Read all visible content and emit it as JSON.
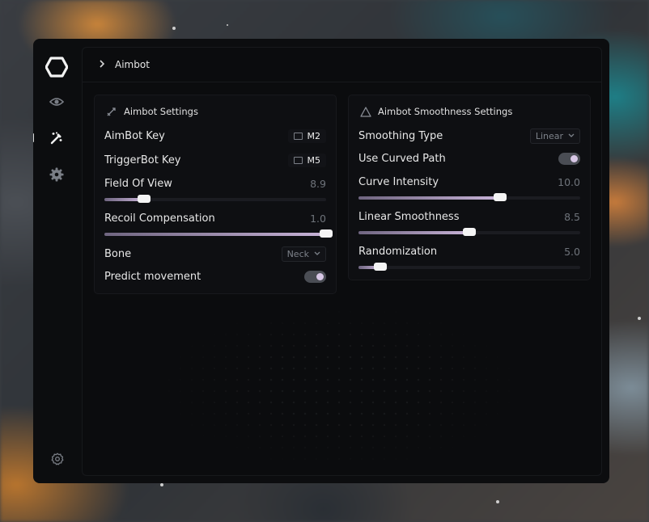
{
  "breadcrumb": {
    "label": "Aimbot"
  },
  "aimbot_settings": {
    "title": "Aimbot Settings",
    "aimbot_key": {
      "label": "AimBot Key",
      "key": "M2"
    },
    "triggerbot_key": {
      "label": "TriggerBot Key",
      "key": "M5"
    },
    "field_of_view": {
      "label": "Field Of View",
      "value": "8.9",
      "fraction": 0.18
    },
    "recoil_compensation": {
      "label": "Recoil Compensation",
      "value": "1.0",
      "fraction": 1.0
    },
    "bone": {
      "label": "Bone",
      "selected": "Neck"
    },
    "predict_movement": {
      "label": "Predict movement",
      "enabled": true
    }
  },
  "smoothness_settings": {
    "title": "Aimbot Smoothness Settings",
    "smoothing_type": {
      "label": "Smoothing Type",
      "selected": "Linear"
    },
    "use_curved_path": {
      "label": "Use Curved Path",
      "enabled": true
    },
    "curve_intensity": {
      "label": "Curve Intensity",
      "value": "10.0",
      "fraction": 0.64
    },
    "linear_smoothness": {
      "label": "Linear Smoothness",
      "value": "8.5",
      "fraction": 0.5
    },
    "randomization": {
      "label": "Randomization",
      "value": "5.0",
      "fraction": 0.1
    }
  },
  "colors": {
    "accent": "#c8b3d8",
    "panel": "#0e0f12",
    "window": "#0c0d0f"
  },
  "icons": {
    "logo": "hexagon-logo-icon",
    "nav": [
      "eye-icon",
      "wand-icon",
      "gear-icon"
    ],
    "bottom": "settings-icon"
  }
}
